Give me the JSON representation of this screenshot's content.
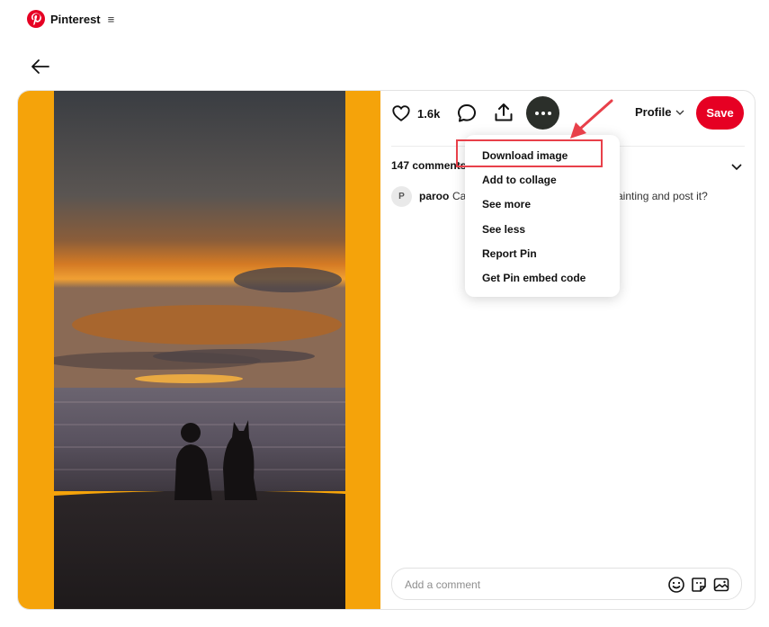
{
  "header": {
    "brand": "Pinterest",
    "menu_icon": "hamburger-icon",
    "logo_color": "#e60023"
  },
  "back_icon": "arrow-left-icon",
  "pin": {
    "like_count": "1.6k",
    "profile_label": "Profile",
    "save_label": "Save",
    "comments_count": "147 comments",
    "comment": {
      "avatar_initial": "P",
      "user": "paroo",
      "text_fragment_1": "Ca",
      "text_fragment_2": "ainting and post it?"
    },
    "comment_placeholder": "Add a comment",
    "colors": {
      "save_button": "#e60023",
      "more_button": "#2b2f2a",
      "media_background": "#f5a30a",
      "annotation": "#e8404a"
    }
  },
  "dropdown": {
    "items": [
      "Download image",
      "Add to collage",
      "See more",
      "See less",
      "Report Pin",
      "Get Pin embed code"
    ]
  }
}
